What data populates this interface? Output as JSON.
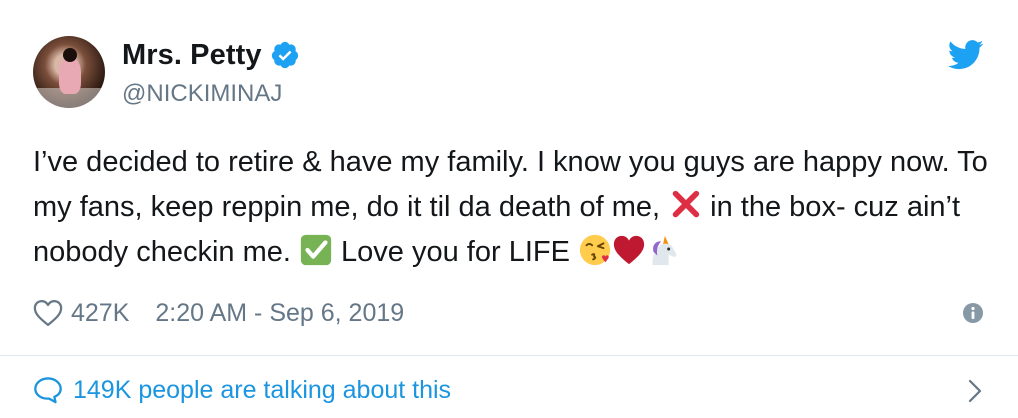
{
  "tweet": {
    "display_name": "Mrs. Petty",
    "handle": "@NICKIMINAJ",
    "verified_icon": "verified-badge-icon",
    "brand_icon": "twitter-bird-icon",
    "text_part1": "I’ve decided to retire & have my family. I know you guys are happy now. To my fans, keep reppin me, do it til da death of me, ",
    "text_part2": " in the box- cuz ain’t nobody checkin me. ",
    "text_part3": " Love you for LIFE ",
    "emojis": [
      "cross-mark",
      "check-mark-button",
      "face-blowing-kiss",
      "red-heart",
      "unicorn"
    ],
    "likes": "427K",
    "timestamp": "2:20 AM - Sep 6, 2019",
    "talking": "149K people are talking about this",
    "colors": {
      "accent": "#1da1f2",
      "link": "#1b95e0",
      "muted": "#657786",
      "text": "#14171a"
    }
  }
}
